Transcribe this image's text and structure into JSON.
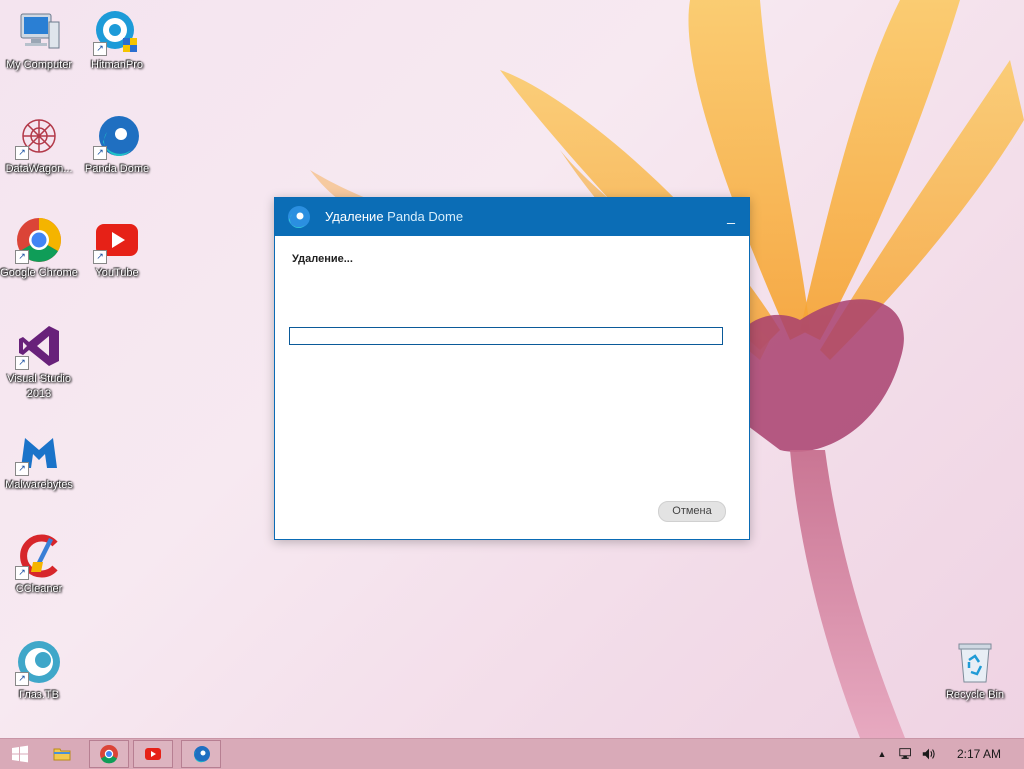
{
  "desktop": {
    "icons": [
      {
        "label": "My Computer",
        "icon": "computer-icon"
      },
      {
        "label": "HitmanPro",
        "icon": "hitmanpro-icon"
      },
      {
        "label": "DataWagon...",
        "icon": "datawagon-icon"
      },
      {
        "label": "Panda Dome",
        "icon": "panda-dome-icon"
      },
      {
        "label": "Google Chrome",
        "icon": "chrome-icon"
      },
      {
        "label": "YouTube",
        "icon": "youtube-icon"
      },
      {
        "label": "Visual Studio 2013",
        "icon": "visual-studio-icon"
      },
      {
        "label": "Malwarebytes",
        "icon": "malwarebytes-icon"
      },
      {
        "label": "CCleaner",
        "icon": "ccleaner-icon"
      },
      {
        "label": "Глаз.ТВ",
        "icon": "glaz-tv-icon"
      },
      {
        "label": "Recycle Bin",
        "icon": "recycle-bin-icon"
      }
    ]
  },
  "dialog": {
    "title_prefix": "Удаление",
    "title_product": "Panda Dome",
    "minimize_glyph": "_",
    "status_text": "Удаление...",
    "progress": 0,
    "cancel_label": "Отмена"
  },
  "taskbar": {
    "clock": "2:17 AM",
    "tray_chevron": "▲",
    "volume_glyph": "🔊"
  },
  "colors": {
    "dialog_accent": "#0b6db6",
    "taskbar": "#d9aab8"
  }
}
